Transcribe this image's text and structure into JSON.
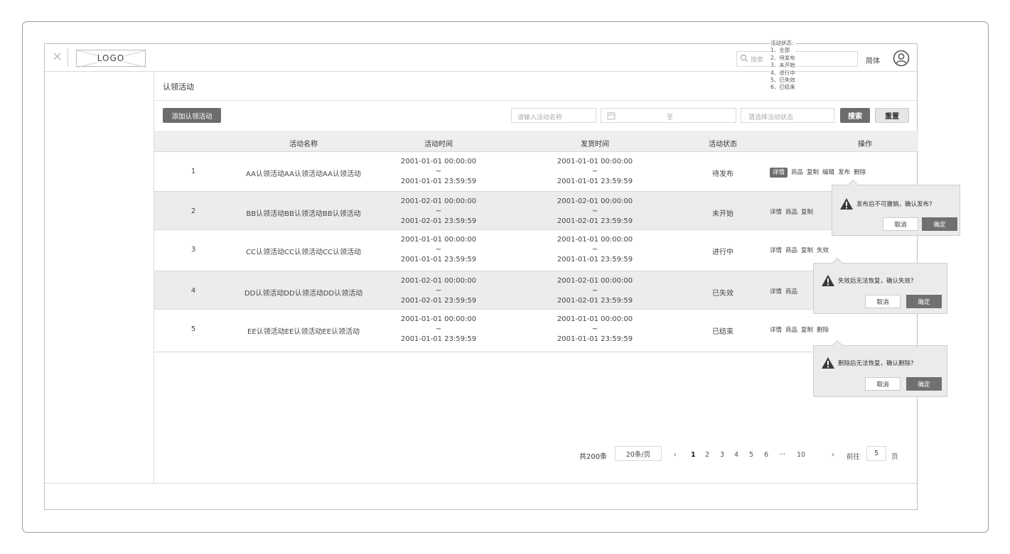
{
  "header": {
    "close_glyph": "×",
    "logo": "LOGO",
    "search_placeholder": "搜索",
    "lang": "简体",
    "status_note": [
      "活动状态:",
      "1、全部",
      "2、待发布",
      "3、未开始",
      "4、进行中",
      "5、已失效",
      "6、已结束"
    ]
  },
  "page": {
    "title": "认领活动"
  },
  "toolbar": {
    "add_label": "添加认领活动",
    "name_placeholder": "请输入活动名称",
    "date_sep": "至",
    "status_placeholder": "请选择活动状态",
    "search_label": "搜索",
    "reset_label": "重置"
  },
  "table": {
    "headers": [
      "活动名称",
      "活动时间",
      "发货时间",
      "活动状态",
      "操作"
    ],
    "rows": [
      {
        "idx": "1",
        "name": "AA认领活动AA认领活动AA认领活动",
        "t_start": "2001-01-01 00:00:00",
        "t_tilde": "~",
        "t_end": "2001-01-01 23:59:59",
        "s_start": "2001-01-01 00:00:00",
        "s_tilde": "~",
        "s_end": "2001-01-01 23:59:59",
        "status": "待发布",
        "ops": [
          "详情",
          "商品",
          "复制",
          "编辑",
          "发布",
          "删除"
        ]
      },
      {
        "idx": "2",
        "name": "BB认领活动BB认领活动BB认领活动",
        "t_start": "2001-02-01 00:00:00",
        "t_tilde": "~",
        "t_end": "2001-02-01 23:59:59",
        "s_start": "2001-02-01 00:00:00",
        "s_tilde": "~",
        "s_end": "2001-02-01 23:59:59",
        "status": "未开始",
        "ops": [
          "详情",
          "商品",
          "复制"
        ]
      },
      {
        "idx": "3",
        "name": "CC认领活动CC认领活动CC认领活动",
        "t_start": "2001-01-01 00:00:00",
        "t_tilde": "~",
        "t_end": "2001-01-01 23:59:59",
        "s_start": "2001-01-01 00:00:00",
        "s_tilde": "~",
        "s_end": "2001-01-01 23:59:59",
        "status": "进行中",
        "ops": [
          "详情",
          "商品",
          "复制",
          "失效"
        ]
      },
      {
        "idx": "4",
        "name": "DD认领活动DD认领活动DD认领活动",
        "t_start": "2001-02-01 00:00:00",
        "t_tilde": "~",
        "t_end": "2001-02-01 23:59:59",
        "s_start": "2001-02-01 00:00:00",
        "s_tilde": "~",
        "s_end": "2001-02-01 23:59:59",
        "status": "已失效",
        "ops": [
          "详情",
          "商品"
        ]
      },
      {
        "idx": "5",
        "name": "EE认领活动EE认领活动EE认领活动",
        "t_start": "2001-01-01 00:00:00",
        "t_tilde": "~",
        "t_end": "2001-01-01 23:59:59",
        "s_start": "2001-01-01 00:00:00",
        "s_tilde": "~",
        "s_end": "2001-01-01 23:59:59",
        "status": "已结束",
        "ops": [
          "详情",
          "商品",
          "复制",
          "删除"
        ]
      }
    ]
  },
  "popovers": {
    "publish": {
      "text": "发布后不可撤销，确认发布?",
      "cancel": "取消",
      "ok": "确定"
    },
    "invalidate": {
      "text": "失效后无法恢复，确认失效?",
      "cancel": "取消",
      "ok": "确定"
    },
    "delete": {
      "text": "删除后无法恢复，确认删除?",
      "cancel": "取消",
      "ok": "确定"
    }
  },
  "pagination": {
    "total": "共200条",
    "page_size": "20条/页",
    "prev": "‹",
    "pages": [
      "1",
      "2",
      "3",
      "4",
      "5",
      "6",
      "···",
      "10"
    ],
    "current": "1",
    "next": "›",
    "goto_label": "前往",
    "goto_value": "5",
    "goto_suffix": "页"
  }
}
